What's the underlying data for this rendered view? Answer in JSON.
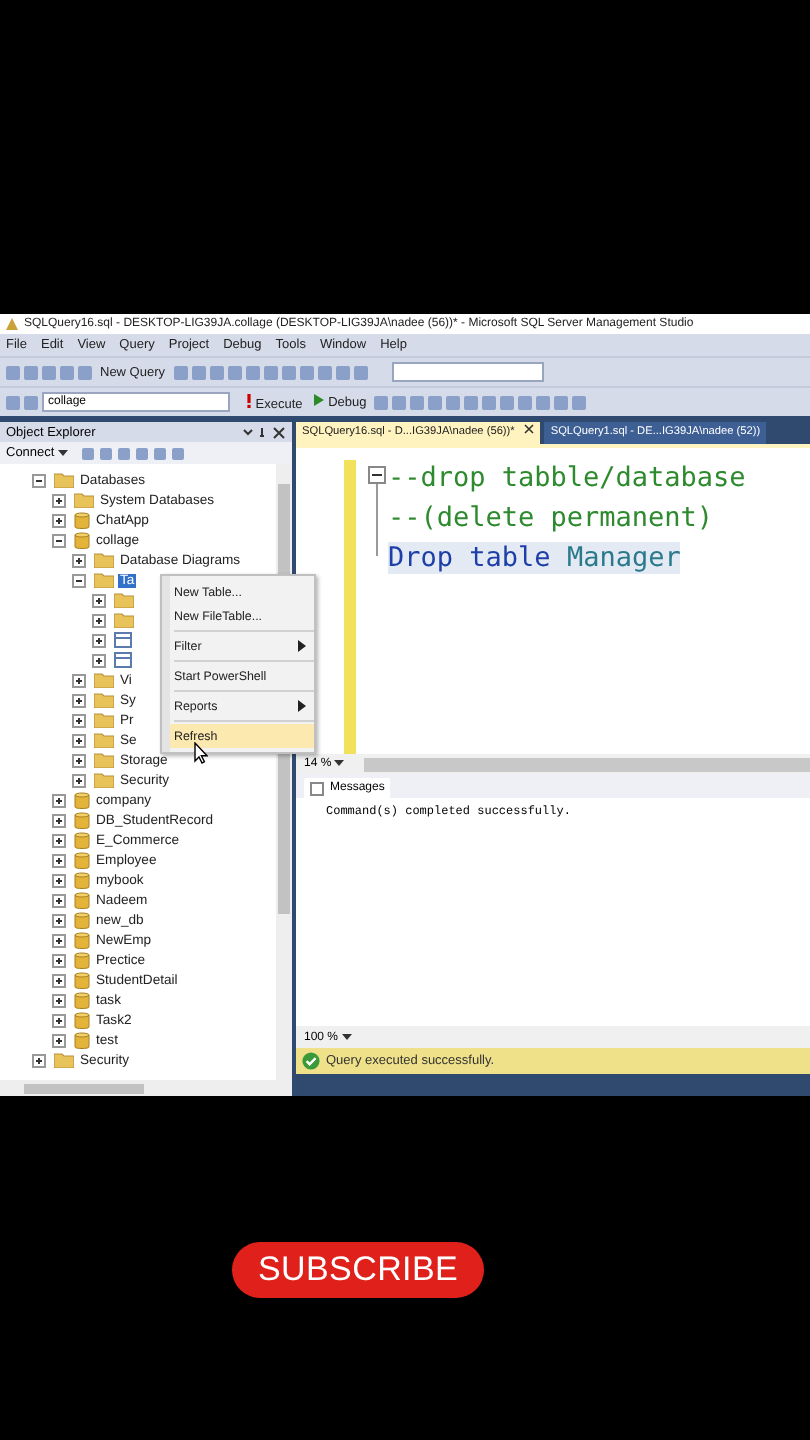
{
  "window": {
    "title": "SQLQuery16.sql - DESKTOP-LIG39JA.collage (DESKTOP-LIG39JA\\nadee (56))* - Microsoft SQL Server Management Studio"
  },
  "menu_bar": [
    "File",
    "Edit",
    "View",
    "Query",
    "Project",
    "Debug",
    "Tools",
    "Window",
    "Help"
  ],
  "toolbar": {
    "new_query": "New Query",
    "database": "collage",
    "execute": "Execute",
    "debug": "Debug"
  },
  "object_explorer": {
    "title": "Object Explorer",
    "connect": "Connect",
    "tree": [
      {
        "label": "Databases",
        "kind": "folder",
        "expanded": true,
        "selected": false,
        "children": [
          {
            "label": "System Databases",
            "kind": "folder",
            "expanded": false,
            "selected": false
          },
          {
            "label": "ChatApp",
            "kind": "database",
            "expanded": false,
            "selected": false
          },
          {
            "label": "collage",
            "kind": "database",
            "expanded": true,
            "selected": false,
            "children": [
              {
                "label": "Database Diagrams",
                "kind": "folder",
                "expanded": false,
                "selected": false
              },
              {
                "label": "Ta",
                "kind": "folder",
                "expanded": true,
                "selected": true,
                "children": [
                  {
                    "kind": "folder",
                    "expanded": false
                  },
                  {
                    "kind": "folder",
                    "expanded": false
                  },
                  {
                    "kind": "table",
                    "expanded": false
                  },
                  {
                    "kind": "table",
                    "expanded": false
                  }
                ]
              },
              {
                "label": "Vi",
                "kind": "folder",
                "expanded": false,
                "selected": false
              },
              {
                "label": "Sy",
                "kind": "folder",
                "expanded": false,
                "selected": false
              },
              {
                "label": "Pr",
                "kind": "folder",
                "expanded": false,
                "selected": false
              },
              {
                "label": "Se",
                "kind": "folder",
                "expanded": false,
                "selected": false
              },
              {
                "label": "Storage",
                "kind": "folder",
                "expanded": false,
                "selected": false
              },
              {
                "label": "Security",
                "kind": "folder",
                "expanded": false,
                "selected": false
              }
            ]
          },
          {
            "label": "company",
            "kind": "database",
            "expanded": false,
            "selected": false
          },
          {
            "label": "DB_StudentRecord",
            "kind": "database",
            "expanded": false,
            "selected": false
          },
          {
            "label": "E_Commerce",
            "kind": "database",
            "expanded": false,
            "selected": false
          },
          {
            "label": "Employee",
            "kind": "database",
            "expanded": false,
            "selected": false
          },
          {
            "label": "mybook",
            "kind": "database",
            "expanded": false,
            "selected": false
          },
          {
            "label": "Nadeem",
            "kind": "database",
            "expanded": false,
            "selected": false
          },
          {
            "label": "new_db",
            "kind": "database",
            "expanded": false,
            "selected": false
          },
          {
            "label": "NewEmp",
            "kind": "database",
            "expanded": false,
            "selected": false
          },
          {
            "label": "Prectice",
            "kind": "database",
            "expanded": false,
            "selected": false
          },
          {
            "label": "StudentDetail",
            "kind": "database",
            "expanded": false,
            "selected": false
          },
          {
            "label": "task",
            "kind": "database",
            "expanded": false,
            "selected": false
          },
          {
            "label": "Task2",
            "kind": "database",
            "expanded": false,
            "selected": false
          },
          {
            "label": "test",
            "kind": "database",
            "expanded": false,
            "selected": false
          }
        ]
      },
      {
        "label": "Security",
        "kind": "folder",
        "expanded": false,
        "selected": false
      }
    ]
  },
  "context_menu": [
    [
      {
        "label": "New Table...",
        "submenu": false,
        "selected": false
      },
      {
        "label": "New FileTable...",
        "submenu": false,
        "selected": false
      }
    ],
    [
      {
        "label": "Filter",
        "submenu": true,
        "selected": false
      }
    ],
    [
      {
        "label": "Start PowerShell",
        "submenu": false,
        "selected": false
      }
    ],
    [
      {
        "label": "Reports",
        "submenu": true,
        "selected": false
      }
    ],
    [
      {
        "label": "Refresh",
        "submenu": false,
        "selected": true
      }
    ]
  ],
  "editor": {
    "tabs": [
      {
        "label": "SQLQuery16.sql - D...IG39JA\\nadee (56))*",
        "selected": true
      },
      {
        "label": "SQLQuery1.sql - DE...IG39JA\\nadee (52))",
        "selected": false
      }
    ],
    "lines": [
      {
        "kind": "comment",
        "text": "--drop tabble/database",
        "highlighted": false
      },
      {
        "kind": "comment",
        "text": "--(delete permanent)",
        "highlighted": false
      },
      {
        "kind": "code",
        "highlighted": true,
        "tokens": [
          {
            "kind": "keyword",
            "text": "Drop"
          },
          {
            "kind": "keyword",
            "text": "table"
          },
          {
            "kind": "name",
            "text": "Manager"
          }
        ]
      }
    ],
    "zoom": "14 %"
  },
  "results": {
    "tab": "Messages",
    "message": "Command(s) completed successfully.",
    "zoom": "100 %"
  },
  "status_bar": {
    "kind": "success",
    "text": "Query executed successfully."
  },
  "subscribe_button": "SUBSCRIBE"
}
